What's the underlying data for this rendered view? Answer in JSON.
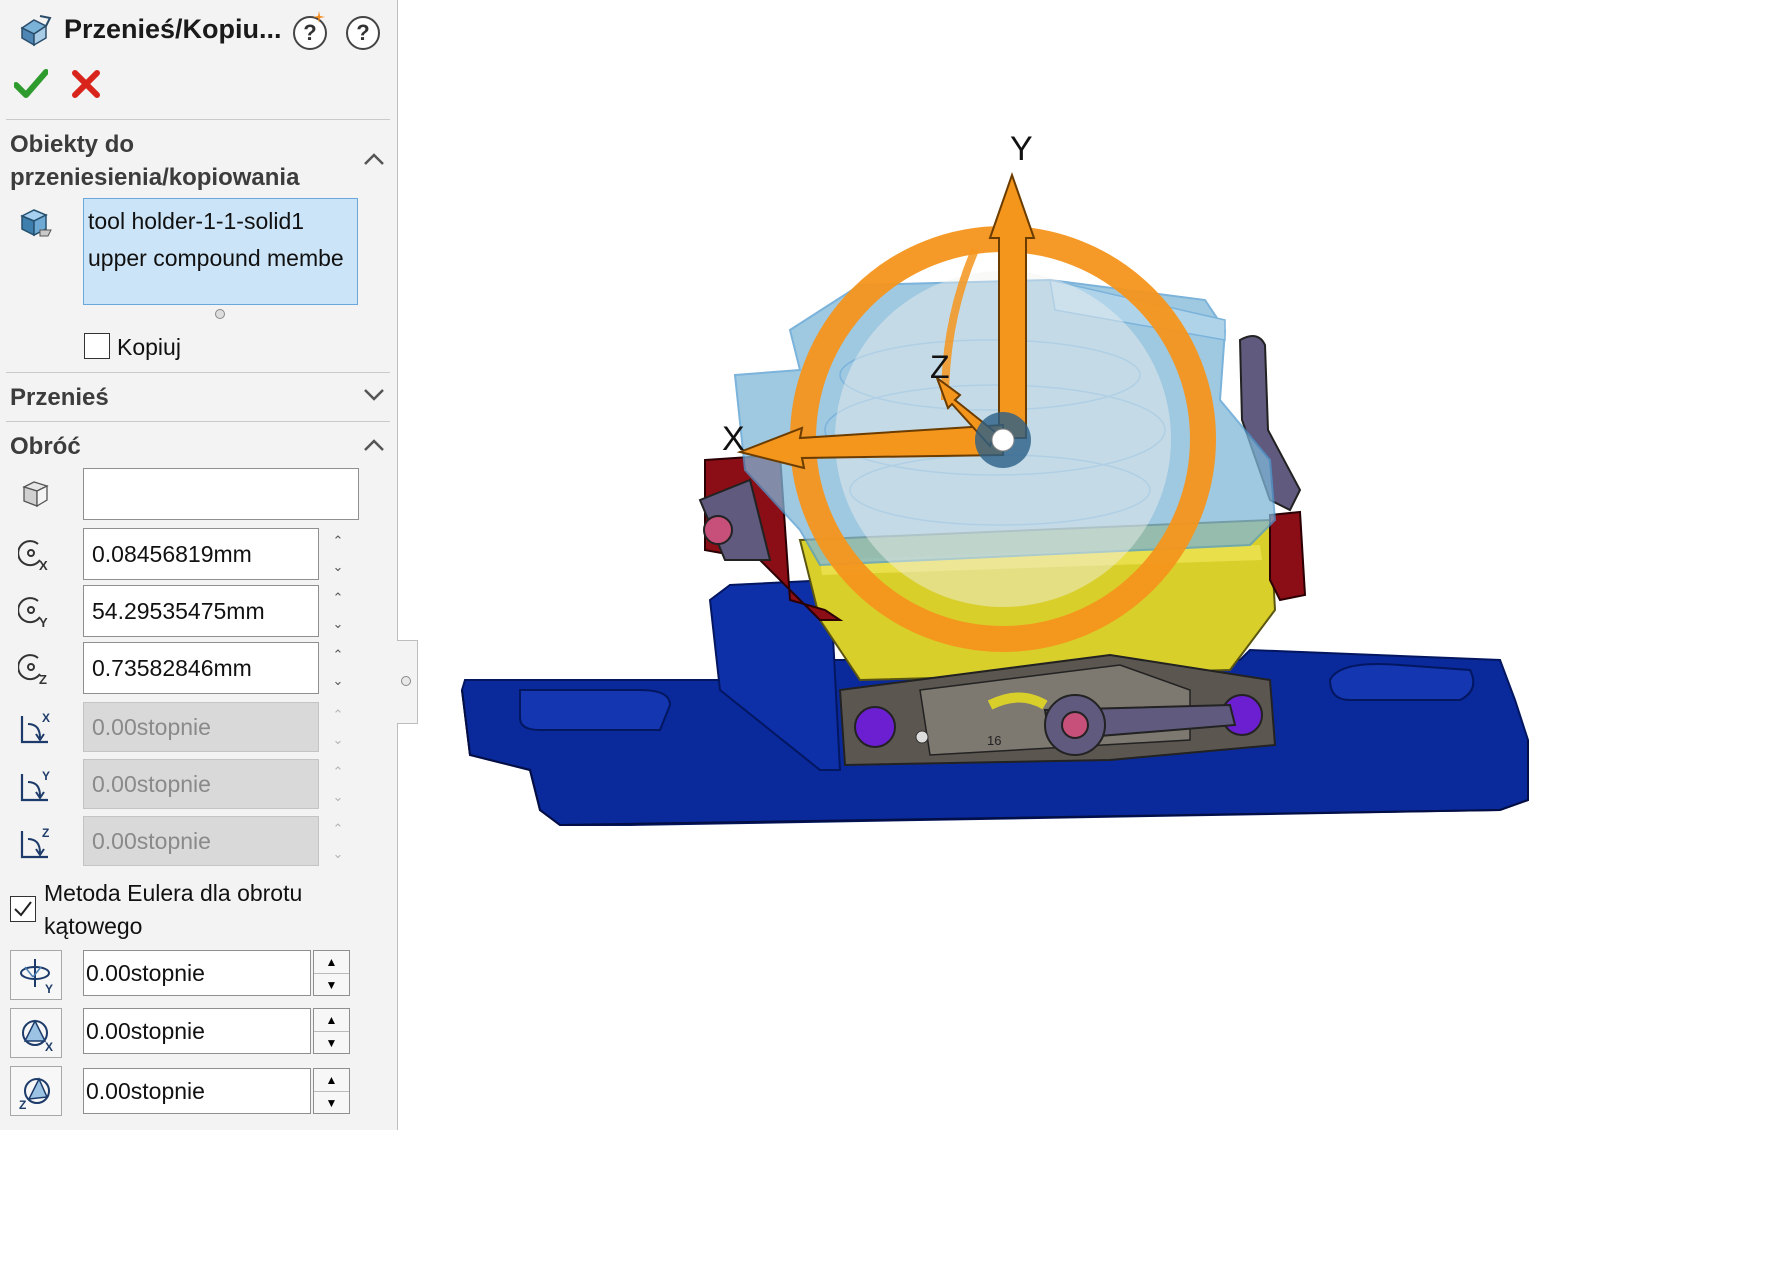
{
  "panel": {
    "title": "Przenieś/Kopiu...",
    "help_label": "?",
    "ok_icon": "checkmark-icon",
    "cancel_icon": "x-icon",
    "objects_section": {
      "title_line1": "Obiekty do",
      "title_line2": "przeniesienia/kopiowania",
      "items": [
        "tool holder-1-1-solid1",
        "upper compound membe"
      ],
      "copy_label": "Kopiuj",
      "copy_checked": false
    },
    "move_section": {
      "title": "Przenieś"
    },
    "rotate_section": {
      "title": "Obróć",
      "reference_value": "",
      "x_value": "0.08456819mm",
      "y_value": "54.29535475mm",
      "z_value": "0.73582846mm",
      "angle_x": "0.00stopnie",
      "angle_y": "0.00stopnie",
      "angle_z": "0.00stopnie",
      "euler_label_line1": "Metoda Eulera dla obrotu",
      "euler_label_line2": "kątowego",
      "euler_checked": true,
      "euler_y": "0.00stopnie",
      "euler_x": "0.00stopnie",
      "euler_z": "0.00stopnie"
    }
  },
  "viewport": {
    "axis_labels": {
      "x": "X",
      "y": "Y",
      "z": "Z"
    },
    "scale_digits": "16",
    "colors": {
      "base": "#0a2a9c",
      "body": "#d9cf2a",
      "clamps": "#8b0d15",
      "triad": "#f4951c",
      "transparent_part": "#7fb6d8",
      "lever": "#5f5a7e"
    }
  }
}
